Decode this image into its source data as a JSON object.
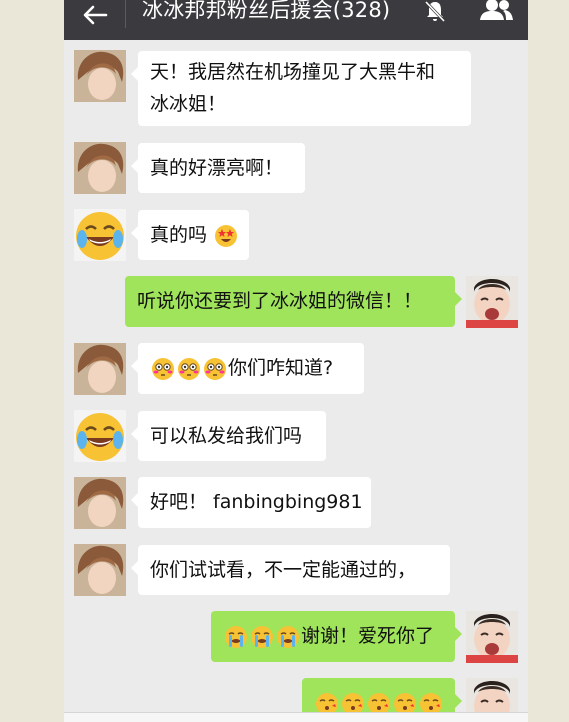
{
  "header": {
    "title": "冰冰邦邦粉丝后援会(328)",
    "back_icon": "arrow-left-icon",
    "mute_icon": "bell-muted-icon",
    "members_icon": "group-members-icon"
  },
  "colors": {
    "header_bg": "#3b3b3f",
    "chat_bg": "#ebebeb",
    "bubble_left": "#ffffff",
    "bubble_right": "#9fe45a"
  },
  "messages": [
    {
      "side": "left",
      "sender_icon": "boy-avatar",
      "line1": "天！我居然在机场撞见了大黑牛和",
      "line2": "冰冰姐！"
    },
    {
      "side": "left",
      "sender_icon": "boy-avatar",
      "text": "真的好漂亮啊！"
    },
    {
      "side": "left",
      "sender_icon": "laughing-emoji-avatar",
      "text": "真的吗",
      "emoji": "star-struck-emoji"
    },
    {
      "side": "right",
      "sender_icon": "crying-baby-avatar",
      "text": "听说你还要到了冰冰姐的微信！！"
    },
    {
      "side": "left",
      "sender_icon": "boy-avatar",
      "text": "你们咋知道?",
      "emoji": "flushed-emoji x3"
    },
    {
      "side": "left",
      "sender_icon": "laughing-emoji-avatar",
      "text": "可以私发给我们吗"
    },
    {
      "side": "left",
      "sender_icon": "boy-avatar",
      "text": "好吧！ fanbingbing981"
    },
    {
      "side": "left",
      "sender_icon": "boy-avatar",
      "text": "你们试试看，不一定能通过的，"
    },
    {
      "side": "right",
      "sender_icon": "crying-baby-avatar",
      "text": "谢谢！爱死你了",
      "emoji": "crying-emoji x3"
    },
    {
      "side": "right",
      "sender_icon": "crying-baby-avatar",
      "text": "",
      "emoji": "kissing-emoji x5"
    }
  ]
}
